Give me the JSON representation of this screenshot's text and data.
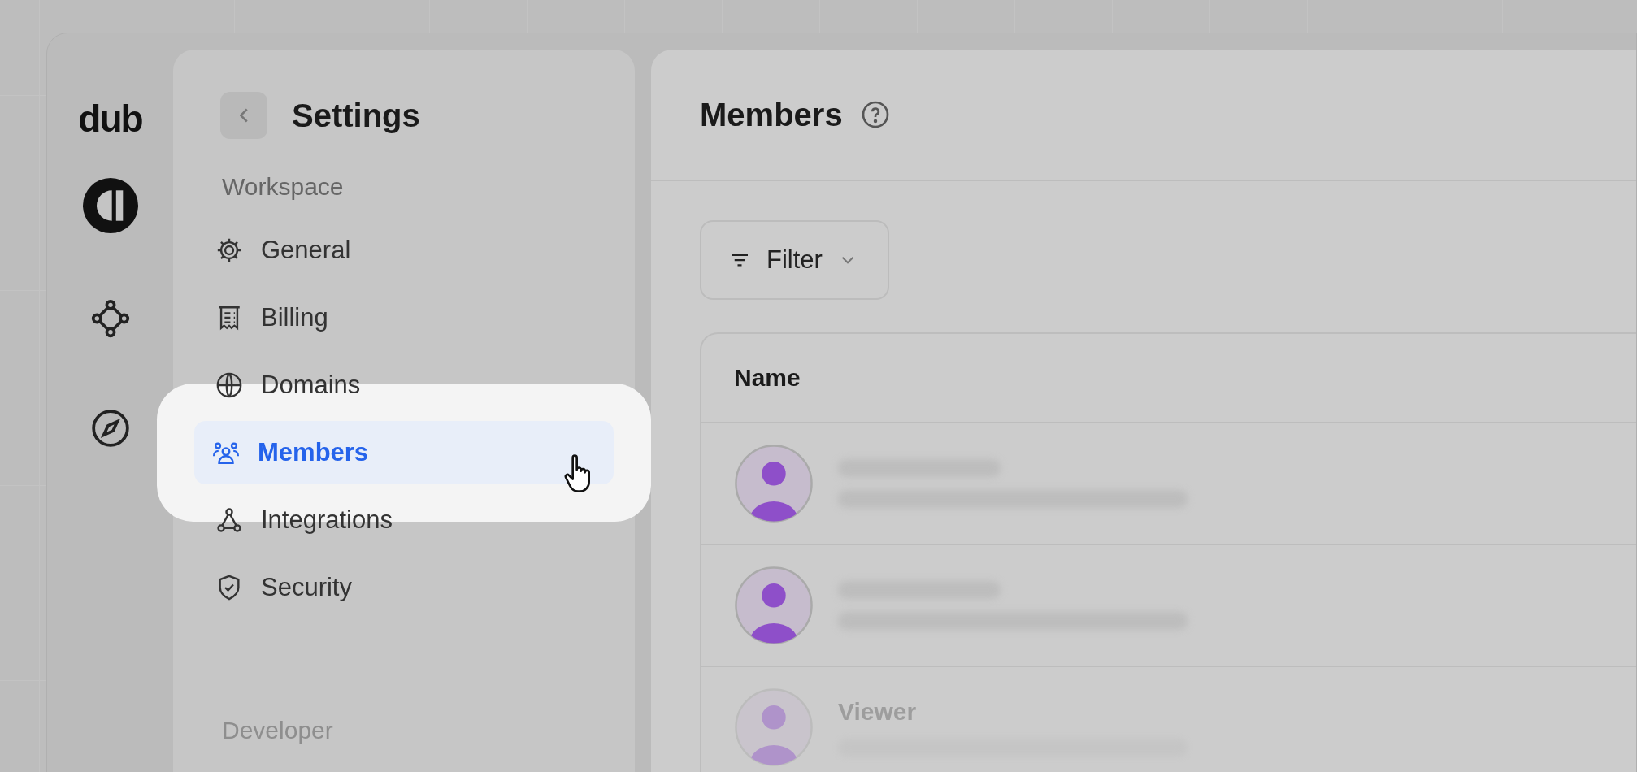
{
  "rail": {
    "logo": "dub"
  },
  "sidebar": {
    "title": "Settings",
    "sections": [
      {
        "label": "Workspace",
        "items": [
          {
            "label": "General",
            "selected": false
          },
          {
            "label": "Billing",
            "selected": false
          },
          {
            "label": "Domains",
            "selected": false
          },
          {
            "label": "Members",
            "selected": true
          },
          {
            "label": "Integrations",
            "selected": false
          },
          {
            "label": "Security",
            "selected": false
          }
        ]
      },
      {
        "label": "Developer"
      }
    ]
  },
  "main": {
    "title": "Members",
    "filter": "Filter",
    "table": {
      "columns": [
        "Name"
      ],
      "rows": [
        {
          "kind": "blurred"
        },
        {
          "kind": "blurred"
        },
        {
          "kind": "faded",
          "name": "Viewer"
        }
      ]
    }
  }
}
